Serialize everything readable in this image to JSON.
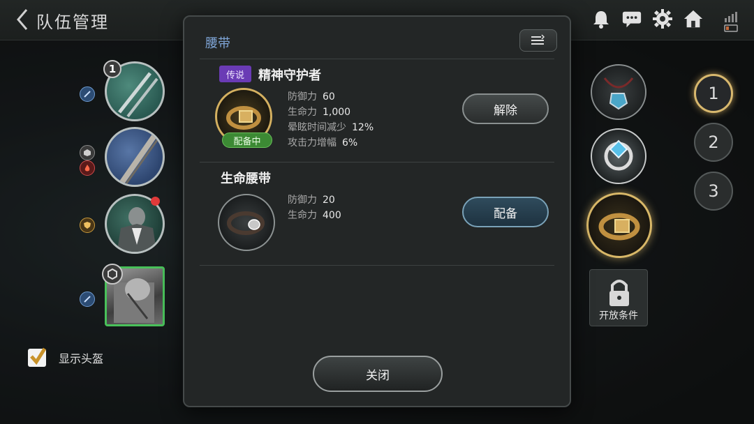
{
  "header": {
    "title": "队伍管理"
  },
  "members": [
    {
      "badge": "1"
    },
    {},
    {},
    {}
  ],
  "show_helmet": {
    "label": "显示头盔",
    "checked": true
  },
  "right_panel": {
    "lock_label": "开放条件",
    "pages": [
      "1",
      "2",
      "3"
    ],
    "active_page": "1"
  },
  "modal": {
    "title": "腰带",
    "items": [
      {
        "tag": "传说",
        "name": "精神守护者",
        "equipped_label": "配备中",
        "stats": [
          {
            "k": "防御力",
            "v": "60"
          },
          {
            "k": "生命力",
            "v": "1,000"
          },
          {
            "k": "晕眩时间减少",
            "v": "12%"
          },
          {
            "k": "攻击力增幅",
            "v": "6%"
          }
        ],
        "action": "解除"
      },
      {
        "name": "生命腰带",
        "stats": [
          {
            "k": "防御力",
            "v": "20"
          },
          {
            "k": "生命力",
            "v": "400"
          }
        ],
        "action": "配备"
      }
    ],
    "close_label": "关闭"
  },
  "colors": {
    "legend_tag": "#6a3bb5",
    "equipped_badge": "#3c8a34",
    "title_blue": "#7fa6d8",
    "gold_ring": "#d4b060"
  },
  "icons": [
    "back-arrow-icon",
    "bell-icon",
    "chat-icon",
    "gear-icon",
    "home-icon",
    "signal-icon",
    "battery-icon",
    "sort-icon",
    "lock-icon",
    "checkmark-icon"
  ]
}
